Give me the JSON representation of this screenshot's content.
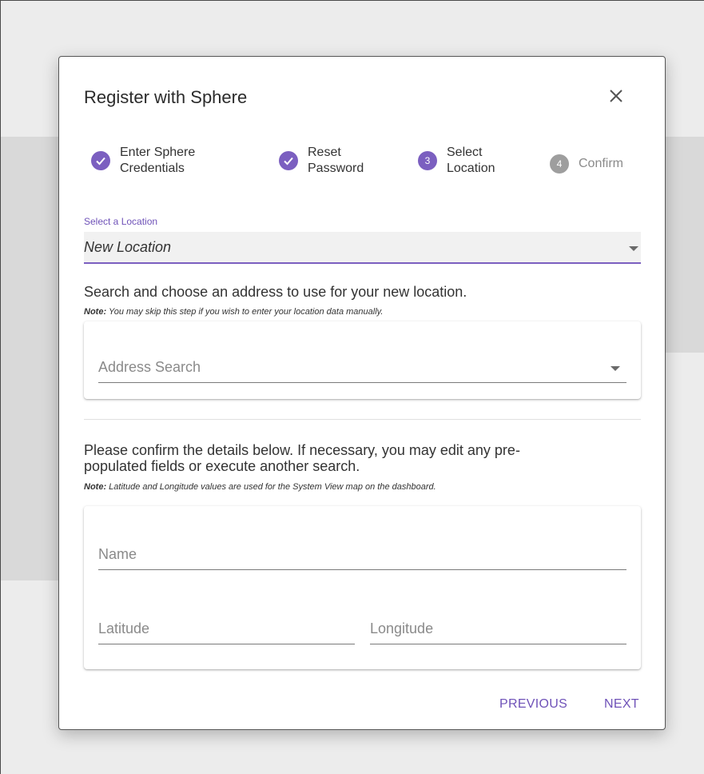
{
  "dialog": {
    "title": "Register with Sphere",
    "close_label": "close"
  },
  "stepper": {
    "steps": [
      {
        "line1": "Enter Sphere",
        "line2": "Credentials",
        "state": "complete",
        "number": ""
      },
      {
        "line1": "Reset",
        "line2": "Password",
        "state": "complete",
        "number": ""
      },
      {
        "line1": "Select",
        "line2": "Location",
        "state": "active",
        "number": "3"
      },
      {
        "line1": "Confirm",
        "line2": "",
        "state": "disabled",
        "number": "4"
      }
    ]
  },
  "location_select": {
    "label": "Select a Location",
    "value": "New Location"
  },
  "address_section": {
    "instruction": "Search and choose an address to use for your new location.",
    "note_prefix": "Note:",
    "note_text": " You may skip this step if you wish to enter your location data manually.",
    "search_placeholder": "Address Search"
  },
  "details_section": {
    "instruction_line1": "Please confirm the details below. If necessary, you may edit any pre-",
    "instruction_line2": "populated fields or execute another search.",
    "note_prefix": "Note:",
    "note_text": " Latitude and Longitude values are used for the System View map on the dashboard.",
    "name_placeholder": "Name",
    "latitude_placeholder": "Latitude",
    "longitude_placeholder": "Longitude"
  },
  "actions": {
    "previous_label": "PREVIOUS",
    "next_label": "NEXT"
  },
  "colors": {
    "accent": "#7b5fc0",
    "disabled_step": "#9e9e9e",
    "backdrop": "#ececec"
  }
}
